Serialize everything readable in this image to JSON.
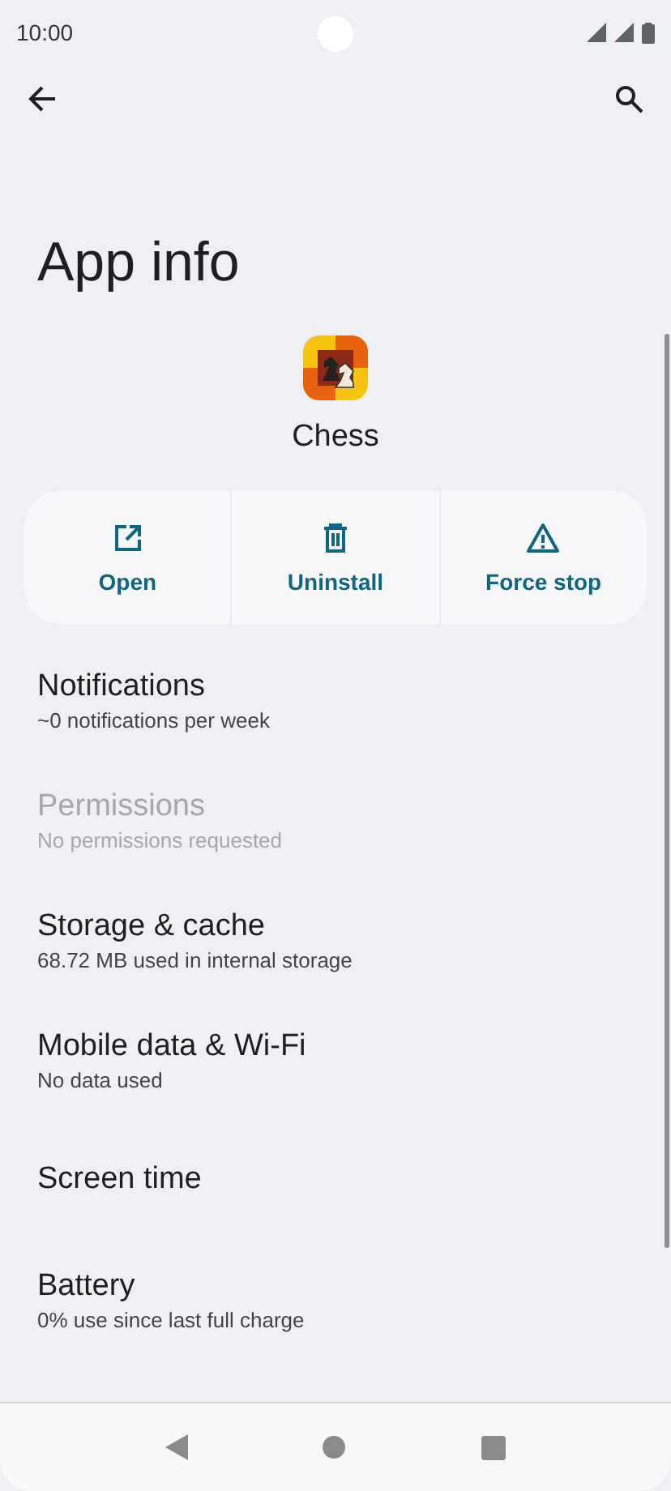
{
  "status_bar": {
    "time": "10:00"
  },
  "title": "App info",
  "app": {
    "name": "Chess"
  },
  "actions": [
    {
      "label": "Open",
      "kind": "open"
    },
    {
      "label": "Uninstall",
      "kind": "uninstall"
    },
    {
      "label": "Force stop",
      "kind": "stop"
    }
  ],
  "settings": [
    {
      "title": "Notifications",
      "subtitle": "~0 notifications per week",
      "disabled": false
    },
    {
      "title": "Permissions",
      "subtitle": "No permissions requested",
      "disabled": true
    },
    {
      "title": "Storage & cache",
      "subtitle": "68.72 MB used in internal storage",
      "disabled": false
    },
    {
      "title": "Mobile data & Wi-Fi",
      "subtitle": "No data used",
      "disabled": false
    },
    {
      "title": "Screen time",
      "disabled": false
    },
    {
      "title": "Battery",
      "subtitle": "0% use since last full charge",
      "disabled": false
    }
  ]
}
